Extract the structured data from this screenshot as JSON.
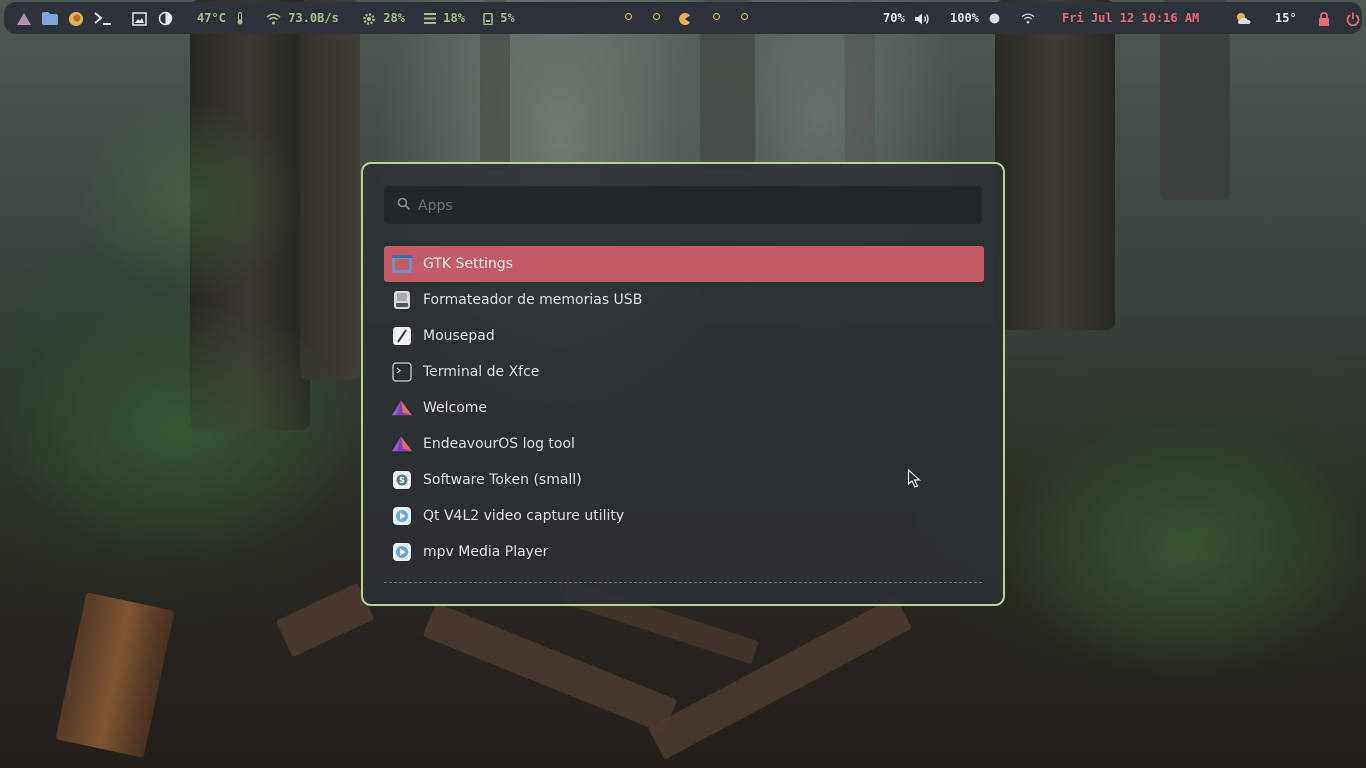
{
  "topbar": {
    "temperature": "47°C",
    "network_speed": "73.0B/s",
    "cpu": "28%",
    "memory": "18%",
    "disk": "5%",
    "volume": "70%",
    "battery": "100%",
    "datetime": "Fri Jul 12 10:16 AM",
    "weather": "15°",
    "colors": {
      "bar_bg": "#2e323a",
      "purple": "#b48ead",
      "blue": "#7aa6da",
      "green": "#a3be8c",
      "yellow": "#e5b24f",
      "white": "#e5e9f0",
      "red": "#e26d78"
    }
  },
  "launcher": {
    "search_placeholder": "Apps",
    "items": [
      {
        "label": "GTK Settings",
        "icon": "gtk-settings-icon",
        "selected": true
      },
      {
        "label": "Formateador de memorias USB",
        "icon": "usb-drive-icon",
        "selected": false
      },
      {
        "label": "Mousepad",
        "icon": "mousepad-icon",
        "selected": false
      },
      {
        "label": "Terminal de Xfce",
        "icon": "terminal-icon",
        "selected": false
      },
      {
        "label": "Welcome",
        "icon": "endeavouros-icon",
        "selected": false
      },
      {
        "label": "EndeavourOS log tool",
        "icon": "endeavouros-icon",
        "selected": false
      },
      {
        "label": "Software Token (small)",
        "icon": "software-token-icon",
        "selected": false
      },
      {
        "label": "Qt V4L2 video capture utility",
        "icon": "video-play-icon",
        "selected": false
      },
      {
        "label": "mpv Media Player",
        "icon": "video-play-icon",
        "selected": false
      }
    ],
    "colors": {
      "border": "#b9d58a",
      "selected": "#c45c65"
    }
  }
}
